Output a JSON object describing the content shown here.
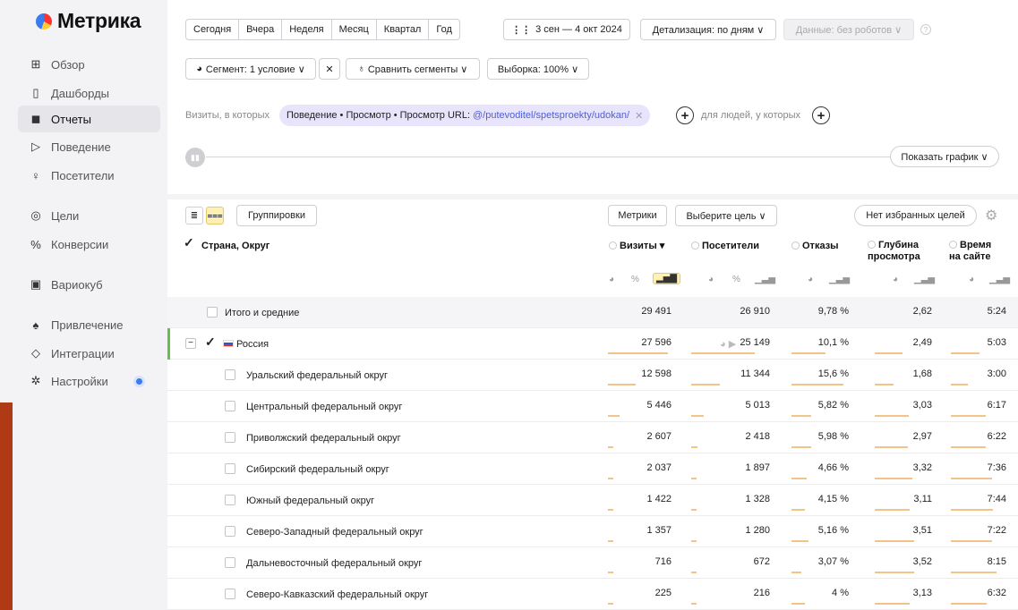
{
  "app": {
    "name": "Метрика"
  },
  "sidebar": {
    "items": [
      {
        "label": "Обзор",
        "icon": "grid-icon",
        "glyph": "⊞"
      },
      {
        "label": "Дашборды",
        "icon": "dashboard-icon",
        "glyph": "▯"
      },
      {
        "label": "Отчеты",
        "icon": "reports-icon",
        "glyph": "◼"
      },
      {
        "label": "Поведение",
        "icon": "play-icon",
        "glyph": "▷"
      },
      {
        "label": "Посетители",
        "icon": "user-icon",
        "glyph": "♀"
      },
      {
        "label": "Цели",
        "icon": "target-icon",
        "glyph": "◎"
      },
      {
        "label": "Конверсии",
        "icon": "percent-icon",
        "glyph": "%"
      },
      {
        "label": "Вариокуб",
        "icon": "cube-icon",
        "glyph": "▣"
      },
      {
        "label": "Привлечение",
        "icon": "fire-icon",
        "glyph": "♠"
      },
      {
        "label": "Интеграции",
        "icon": "puzzle-icon",
        "glyph": "◇"
      },
      {
        "label": "Настройки",
        "icon": "gear-icon",
        "glyph": "✲"
      }
    ],
    "active": "Отчеты"
  },
  "toolbar": {
    "periods": [
      "Сегодня",
      "Вчера",
      "Неделя",
      "Месяц",
      "Квартал",
      "Год"
    ],
    "date_range": "3 сен — 4 окт 2024",
    "detail": "Детализация: по дням ∨",
    "data_filter": "Данные: без роботов ∨",
    "segment": "Сегмент: 1 условие ∨",
    "compare": "Сравнить сегменты ∨",
    "sample": "Выборка: 100% ∨"
  },
  "filter": {
    "prefix": "Визиты, в которых",
    "condition": "Поведение • Просмотр • Просмотр URL:",
    "url": "@/putevoditel/spetsproekty/udokan/",
    "people_label": "для людей, у которых"
  },
  "chart_toggle": "Показать график ∨",
  "table_toolbar": {
    "groupings": "Группировки",
    "metrics": "Метрики",
    "goal": "Выберите цель ∨",
    "favorites": "Нет избранных целей"
  },
  "table": {
    "dimension_header": "Страна, Округ",
    "columns": [
      "Визиты ▾",
      "Посетители",
      "Отказы",
      "Глубина просмотра",
      "Время на сайте"
    ],
    "total": {
      "name": "Итого и средние",
      "values": [
        "29 491",
        "26 910",
        "9,78 %",
        "2,62",
        "5:24"
      ]
    },
    "rows": [
      {
        "name": "Россия",
        "values": [
          "27 596",
          "25 149",
          "10,1 %",
          "2,49",
          "5:03"
        ]
      },
      {
        "name": "Уральский федеральный округ",
        "values": [
          "12 598",
          "11 344",
          "15,6 %",
          "1,68",
          "3:00"
        ]
      },
      {
        "name": "Центральный федеральный округ",
        "values": [
          "5 446",
          "5 013",
          "5,82 %",
          "3,03",
          "6:17"
        ]
      },
      {
        "name": "Приволжский федеральный округ",
        "values": [
          "2 607",
          "2 418",
          "5,98 %",
          "2,97",
          "6:22"
        ]
      },
      {
        "name": "Сибирский федеральный округ",
        "values": [
          "2 037",
          "1 897",
          "4,66 %",
          "3,32",
          "7:36"
        ]
      },
      {
        "name": "Южный федеральный округ",
        "values": [
          "1 422",
          "1 328",
          "4,15 %",
          "3,11",
          "7:44"
        ]
      },
      {
        "name": "Северо-Западный федеральный округ",
        "values": [
          "1 357",
          "1 280",
          "5,16 %",
          "3,51",
          "7:22"
        ]
      },
      {
        "name": "Дальневосточный федеральный округ",
        "values": [
          "716",
          "672",
          "3,07 %",
          "3,52",
          "8:15"
        ]
      },
      {
        "name": "Северо-Кавказский федеральный округ",
        "values": [
          "225",
          "216",
          "4 %",
          "3,13",
          "6:32"
        ]
      }
    ]
  },
  "colors": {
    "accent": "#3a7bf0",
    "chip": "#e7e4fb",
    "bar": "#f2c489",
    "active_icon": "#fff1b5",
    "russia_marker": "#63c14a"
  }
}
